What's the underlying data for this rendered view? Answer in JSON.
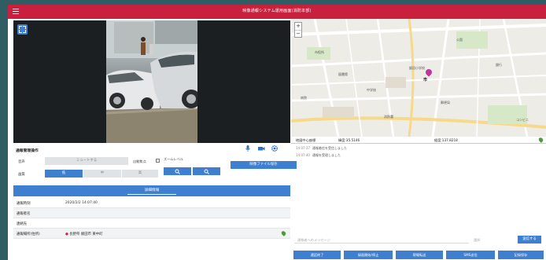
{
  "header": {
    "title": "映像通報システム運用画面(消防本部)"
  },
  "video": {
    "fullscreen": "fullscreen-icon"
  },
  "controls": {
    "section_title": "通報管理操作",
    "row1_label": "音声",
    "mute_button": "ミュートする",
    "auto_focus_label": "自動焦点",
    "zoom_label": "ズームレベル",
    "row2_label": "画質",
    "quality_options": [
      "低",
      "中",
      "高"
    ],
    "zoom_in_icon": "zoom-in-icon",
    "zoom_out_icon": "zoom-out-icon",
    "video_file_button": "映像ファイル保存",
    "icons": [
      "microphone-icon",
      "video-camera-icon",
      "gear-icon"
    ]
  },
  "detail": {
    "header": "詳細情報",
    "rows": [
      {
        "key": "通報時刻",
        "value": "2020/2/2 14:07:40"
      },
      {
        "key": "通報者名",
        "value": ""
      },
      {
        "key": "連絡先",
        "value": ""
      },
      {
        "key": "通報場所(住所)",
        "value": "長野県 飯田市 東中町"
      }
    ]
  },
  "map": {
    "pin_label": "市",
    "labels": [
      "市役所",
      "公園",
      "飯田小学校",
      "中学校",
      "病院",
      "郵便局",
      "銀行",
      "コンビニ",
      "図書館",
      "消防署"
    ]
  },
  "info": {
    "place": "地図中心座標",
    "lat": "緯度:35.5146",
    "lng": "経度:137.8218",
    "logs": [
      {
        "time": "14:07:37",
        "text": "通報着信を受信しました"
      },
      {
        "time": "14:07:40",
        "text": "通報を受理しました"
      }
    ]
  },
  "message": {
    "placeholder": "通報者へのメッセージ",
    "select": "選択",
    "send": "送信する"
  },
  "footer": {
    "buttons": [
      "通話終了",
      "録画開始/停止",
      "現場転送",
      "SMS送信",
      "記録保存"
    ]
  },
  "colors": {
    "header": "#c9213d",
    "accent": "#3f7fd0",
    "frame": "#2f5d63"
  }
}
